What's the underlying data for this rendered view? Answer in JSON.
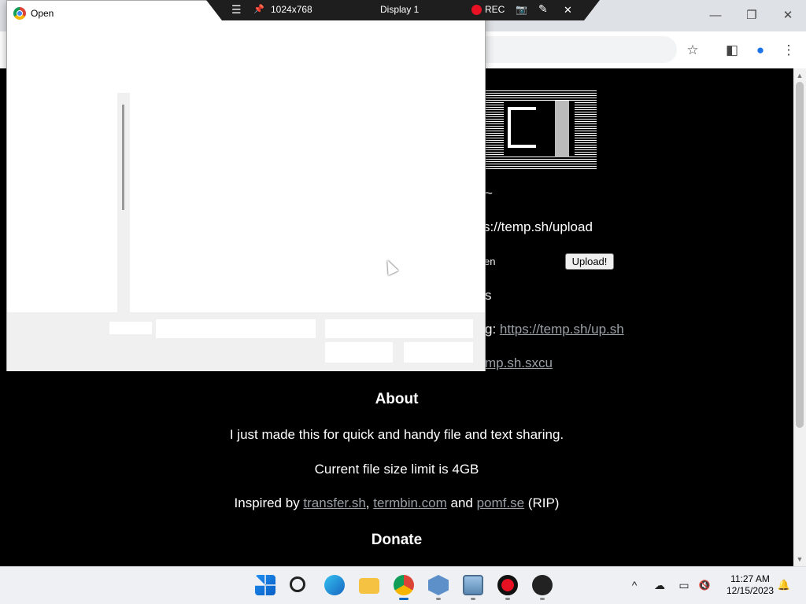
{
  "browser": {
    "controls": {
      "minimize": "—",
      "restore": "❐",
      "close": "✕"
    },
    "toolbar_icons": {
      "bookmark": "☆",
      "sidepanel": "◧",
      "profile": "●",
      "menu": "⋮"
    }
  },
  "page": {
    "tagline": "~",
    "curl_upload": "s://temp.sh/upload",
    "file_status": "en",
    "upload_button": "Upload!",
    "s_line": "s",
    "script_prefix": "g: ",
    "script_link": "https://temp.sh/up.sh",
    "sharex_link": "mp.sh.sxcu",
    "about_heading": "About",
    "about_text": "I just made this for quick and handy file and text sharing.",
    "limit_text": "Current file size limit is 4GB",
    "inspired": {
      "prefix": "Inspired by ",
      "link1": "transfer.sh",
      "sep1": ", ",
      "link2": "termbin.com",
      "sep2": " and ",
      "link3": "pomf.se",
      "suffix": " (RIP)"
    },
    "donate_heading": "Donate"
  },
  "dialog": {
    "title": "Open"
  },
  "recorder": {
    "menu_icon": "☰",
    "pin_icon": "📌",
    "resolution": "1024x768",
    "display": "Display 1",
    "rec_label": "REC",
    "camera_icon": "📷",
    "pen_icon": "✎",
    "close_icon": "✕"
  },
  "taskbar": {
    "tray": {
      "chevron": "^",
      "cloud": "☁",
      "network": "▭",
      "volume": "🔇"
    },
    "time": "11:27 AM",
    "date": "12/15/2023",
    "bell": "🔔"
  },
  "colors": {
    "page_bg": "#000000",
    "link": "#9aa0a6",
    "rec_red": "#e81123",
    "taskbar_bg": "#eef0f4"
  }
}
